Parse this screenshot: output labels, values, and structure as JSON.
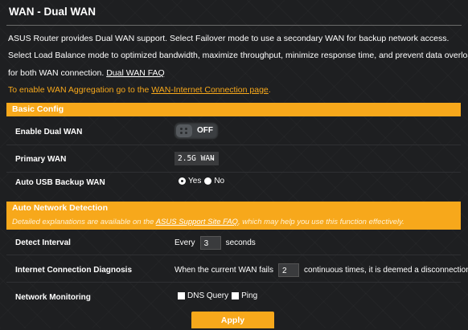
{
  "page": {
    "title": "WAN - Dual WAN",
    "description_lines": [
      "ASUS Router provides Dual WAN support. Select Failover mode to use a secondary WAN for backup network access.",
      "Select Load Balance mode to optimized bandwidth, maximize throughput, minimize response time, and prevent data overload",
      "for both WAN connection."
    ],
    "faq_link": "Dual WAN FAQ",
    "aggregation_text": "To enable WAN Aggregation go to the ",
    "aggregation_link": "WAN-Internet Connection page",
    "aggregation_suffix": "."
  },
  "basic_config": {
    "header": "Basic Config",
    "enable_dual_wan_label": "Enable Dual WAN",
    "enable_dual_wan_state": "OFF",
    "primary_wan_label": "Primary WAN",
    "primary_wan_value": "2.5G WAN",
    "auto_usb_label": "Auto USB Backup WAN",
    "auto_usb_yes": "Yes",
    "auto_usb_no": "No",
    "auto_usb_selected": "Yes"
  },
  "auto_detection": {
    "header": "Auto Network Detection",
    "note_prefix": "Detailed explanations are available on the ",
    "note_link": "ASUS Support Site FAQ",
    "note_suffix": ", which may help you use this function effectively.",
    "detect_interval_label": "Detect Interval",
    "every_text": "Every",
    "interval_value": "3",
    "seconds_text": "seconds",
    "diagnosis_label": "Internet Connection Diagnosis",
    "diagnosis_prefix": "When the current WAN fails",
    "diagnosis_value": "2",
    "diagnosis_suffix": "continuous times, it is deemed a disconnection.",
    "monitoring_label": "Network Monitoring",
    "dns_query_label": "DNS Query",
    "ping_label": "Ping"
  },
  "actions": {
    "apply_label": "Apply"
  },
  "colors": {
    "accent": "#f7a81b",
    "background": "#1e1f21"
  }
}
